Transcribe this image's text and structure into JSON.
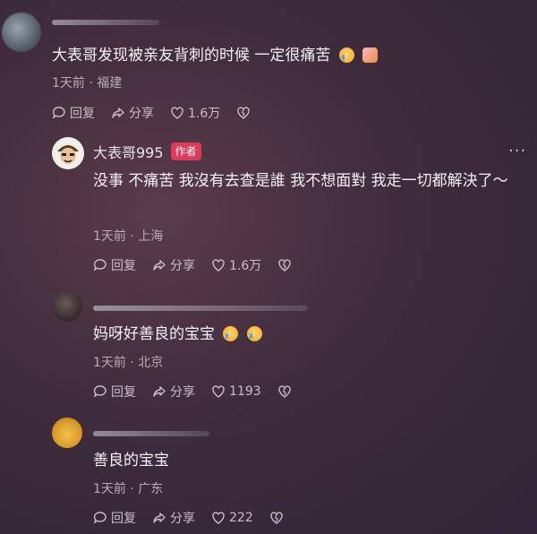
{
  "comments": [
    {
      "text": "大表哥发现被亲友背刺的时候 一定很痛苦",
      "emojis": [
        "crying-face-emoji",
        "hugging-people-emoji"
      ],
      "meta": "1天前 · 福建",
      "reply_label": "回复",
      "share_label": "分享",
      "likes": "1.6万"
    },
    {
      "username": "大表哥995",
      "badge": "作者",
      "text": "没事 不痛苦 我沒有去查是誰 我不想面對 我走一切都解決了～",
      "meta": "1天前 · 上海",
      "reply_label": "回复",
      "share_label": "分享",
      "likes": "1.6万"
    },
    {
      "text": "妈呀好善良的宝宝",
      "emojis": [
        "crying-face-emoji",
        "crying-face-emoji"
      ],
      "meta": "1天前 · 北京",
      "reply_label": "回复",
      "share_label": "分享",
      "likes": "1193"
    },
    {
      "text": "善良的宝宝",
      "meta": "1天前 · 广东",
      "reply_label": "回复",
      "share_label": "分享",
      "likes": "222"
    }
  ],
  "colors": {
    "badge": "#e03a5a",
    "background": "#3f2c3c"
  }
}
